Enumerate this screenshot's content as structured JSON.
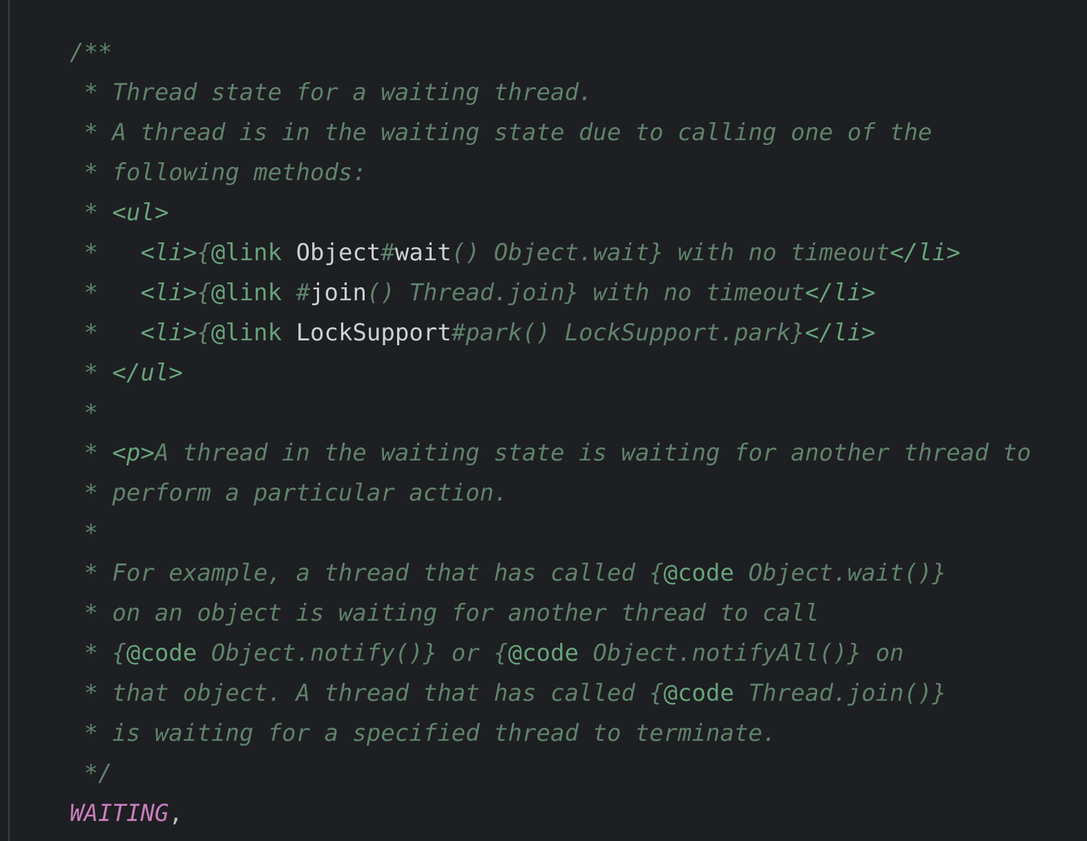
{
  "colors": {
    "background": "#1e1f22",
    "doc_comment": "#5f826b",
    "doc_tag": "#67a37c",
    "reference": "#ced0d6",
    "enum_constant": "#c77dbb",
    "punctuation": "#bcbec4"
  },
  "lines": [
    {
      "segments": [
        {
          "cls": "doc",
          "text": "/**"
        }
      ]
    },
    {
      "segments": [
        {
          "cls": "doc",
          "text": " * Thread state for a waiting thread."
        }
      ]
    },
    {
      "segments": [
        {
          "cls": "doc",
          "text": " * A thread is in the waiting state due to calling one of the"
        }
      ]
    },
    {
      "segments": [
        {
          "cls": "doc",
          "text": " * following methods:"
        }
      ]
    },
    {
      "segments": [
        {
          "cls": "doc",
          "text": " * "
        },
        {
          "cls": "tag",
          "text": "<ul>"
        }
      ]
    },
    {
      "segments": [
        {
          "cls": "doc",
          "text": " *   "
        },
        {
          "cls": "tag",
          "text": "<li>"
        },
        {
          "cls": "doc",
          "text": "{"
        },
        {
          "cls": "kw",
          "text": "@link "
        },
        {
          "cls": "ref",
          "text": "Object"
        },
        {
          "cls": "doc",
          "text": "#"
        },
        {
          "cls": "ref",
          "text": "wait"
        },
        {
          "cls": "doc",
          "text": "() Object.wait} with no timeout"
        },
        {
          "cls": "tag",
          "text": "</li>"
        }
      ]
    },
    {
      "segments": [
        {
          "cls": "doc",
          "text": " *   "
        },
        {
          "cls": "tag",
          "text": "<li>"
        },
        {
          "cls": "doc",
          "text": "{"
        },
        {
          "cls": "kw",
          "text": "@link "
        },
        {
          "cls": "doc",
          "text": "#"
        },
        {
          "cls": "ref",
          "text": "join"
        },
        {
          "cls": "doc",
          "text": "() Thread.join} with no timeout"
        },
        {
          "cls": "tag",
          "text": "</li>"
        }
      ]
    },
    {
      "segments": [
        {
          "cls": "doc",
          "text": " *   "
        },
        {
          "cls": "tag",
          "text": "<li>"
        },
        {
          "cls": "doc",
          "text": "{"
        },
        {
          "cls": "kw",
          "text": "@link "
        },
        {
          "cls": "ref",
          "text": "LockSupport"
        },
        {
          "cls": "doc",
          "text": "#park() LockSupport.park}"
        },
        {
          "cls": "tag",
          "text": "</li>"
        }
      ]
    },
    {
      "segments": [
        {
          "cls": "doc",
          "text": " * "
        },
        {
          "cls": "tag",
          "text": "</ul>"
        }
      ]
    },
    {
      "segments": [
        {
          "cls": "doc",
          "text": " *"
        }
      ]
    },
    {
      "segments": [
        {
          "cls": "doc",
          "text": " * "
        },
        {
          "cls": "tag",
          "text": "<p>"
        },
        {
          "cls": "doc",
          "text": "A thread in the waiting state is waiting for another thread to"
        }
      ]
    },
    {
      "segments": [
        {
          "cls": "doc",
          "text": " * perform a particular action."
        }
      ]
    },
    {
      "segments": [
        {
          "cls": "doc",
          "text": " *"
        }
      ]
    },
    {
      "segments": [
        {
          "cls": "doc",
          "text": " * For example, a thread that has called {"
        },
        {
          "cls": "kw",
          "text": "@code"
        },
        {
          "cls": "doc",
          "text": " Object.wait()}"
        }
      ]
    },
    {
      "segments": [
        {
          "cls": "doc",
          "text": " * on an object is waiting for another thread to call"
        }
      ]
    },
    {
      "segments": [
        {
          "cls": "doc",
          "text": " * {"
        },
        {
          "cls": "kw",
          "text": "@code"
        },
        {
          "cls": "doc",
          "text": " Object.notify()} or {"
        },
        {
          "cls": "kw",
          "text": "@code"
        },
        {
          "cls": "doc",
          "text": " Object.notifyAll()} on"
        }
      ]
    },
    {
      "segments": [
        {
          "cls": "doc",
          "text": " * that object. A thread that has called {"
        },
        {
          "cls": "kw",
          "text": "@code"
        },
        {
          "cls": "doc",
          "text": " Thread.join()}"
        }
      ]
    },
    {
      "segments": [
        {
          "cls": "doc",
          "text": " * is waiting for a specified thread to terminate."
        }
      ]
    },
    {
      "segments": [
        {
          "cls": "doc",
          "text": " */"
        }
      ]
    },
    {
      "segments": [
        {
          "cls": "const",
          "text": "WAITING"
        },
        {
          "cls": "punct",
          "text": ","
        }
      ]
    }
  ]
}
